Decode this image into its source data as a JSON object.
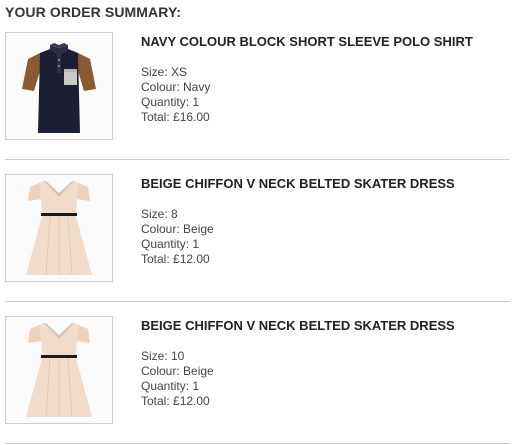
{
  "summary": {
    "title": "YOUR ORDER SUMMARY:"
  },
  "items": [
    {
      "name": "NAVY COLOUR BLOCK SHORT SLEEVE POLO SHIRT",
      "image_icon": "polo-shirt-image",
      "size": "Size: XS",
      "colour": "Colour: Navy",
      "quantity": "Quantity: 1",
      "total": "Total: £16.00"
    },
    {
      "name": "BEIGE CHIFFON V NECK BELTED SKATER DRESS",
      "image_icon": "skater-dress-image",
      "size": "Size: 8",
      "colour": "Colour: Beige",
      "quantity": "Quantity: 1",
      "total": "Total: £12.00"
    },
    {
      "name": "BEIGE CHIFFON V NECK BELTED SKATER DRESS",
      "image_icon": "skater-dress-image",
      "size": "Size: 10",
      "colour": "Colour: Beige",
      "quantity": "Quantity: 1",
      "total": "Total: £12.00"
    }
  ],
  "colors": {
    "navy": "#1c1f33",
    "tan": "#8a5a32",
    "beige": "#f1dccb",
    "belt": "#1a1a1a",
    "divider": "#cccccc"
  }
}
